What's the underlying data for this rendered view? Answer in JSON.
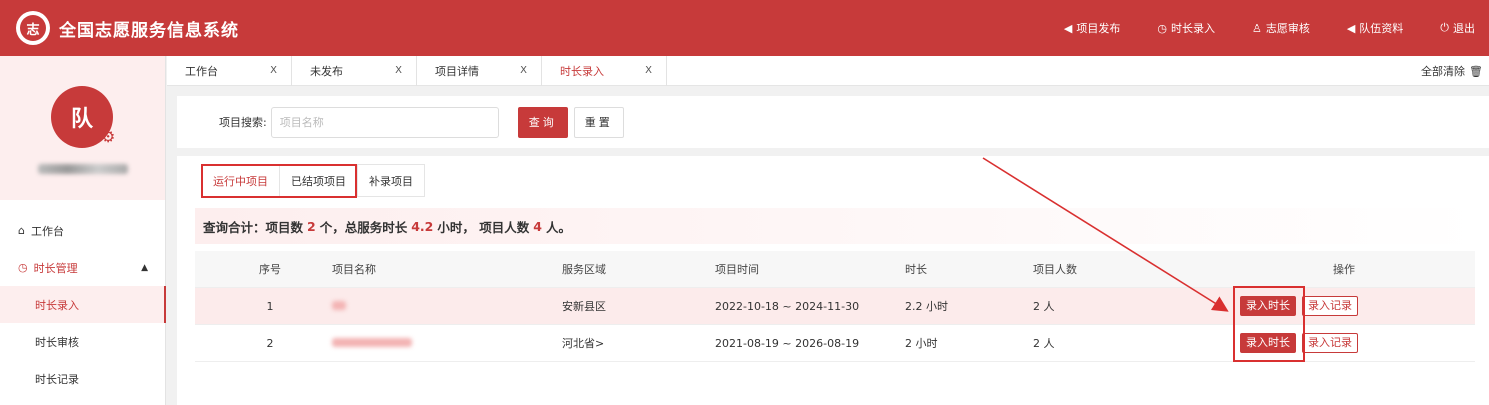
{
  "header": {
    "logo_glyph": "志",
    "title": "全国志愿服务信息系统",
    "nav": [
      {
        "icon": "send-icon",
        "glyph": "◀",
        "label": "项目发布"
      },
      {
        "icon": "clock-icon",
        "glyph": "◷",
        "label": "时长录入"
      },
      {
        "icon": "user-icon",
        "glyph": "♙",
        "label": "志愿审核"
      },
      {
        "icon": "send-icon",
        "glyph": "◀",
        "label": "队伍资料"
      },
      {
        "icon": "logout-icon",
        "glyph": "⏻",
        "label": "退出"
      }
    ]
  },
  "sidebar": {
    "avatar_text": "队",
    "menu": {
      "workbench": "工作台",
      "duration_mgmt": "时长管理",
      "items": [
        "时长录入",
        "时长审核",
        "时长记录"
      ]
    }
  },
  "tabs": [
    {
      "label": "工作台",
      "close": "X"
    },
    {
      "label": "未发布",
      "close": "X"
    },
    {
      "label": "项目详情",
      "close": "X"
    },
    {
      "label": "时长录入",
      "close": "X"
    }
  ],
  "clear_all": "全部清除",
  "search": {
    "label": "项目搜索:",
    "placeholder": "项目名称",
    "query_label": "查询",
    "reset_label": "重置"
  },
  "subtabs": [
    "运行中项目",
    "已结项项目",
    "补录项目"
  ],
  "summary": {
    "prefix": "查询合计：项目数",
    "project_count": "2",
    "mid1": "个，总服务时长",
    "total_hours": "4.2",
    "mid2": "小时，  项目人数",
    "people_count": "4",
    "suffix": "人。"
  },
  "table": {
    "columns": [
      "序号",
      "项目名称",
      "服务区域",
      "项目时间",
      "时长",
      "项目人数",
      "操作"
    ],
    "rows": [
      {
        "idx": "1",
        "area": "安新县区",
        "time": "2022-10-18 ~ 2024-11-30",
        "duration": "2.2 小时",
        "people": "2 人"
      },
      {
        "idx": "2",
        "area": "河北省>",
        "time": "2021-08-19 ~ 2026-08-19",
        "duration": "2 小时",
        "people": "2 人"
      }
    ],
    "op_enter": "录入时长",
    "op_record": "录入记录"
  },
  "colors": {
    "brand": "#c73a3a",
    "highlight": "#d93030"
  }
}
